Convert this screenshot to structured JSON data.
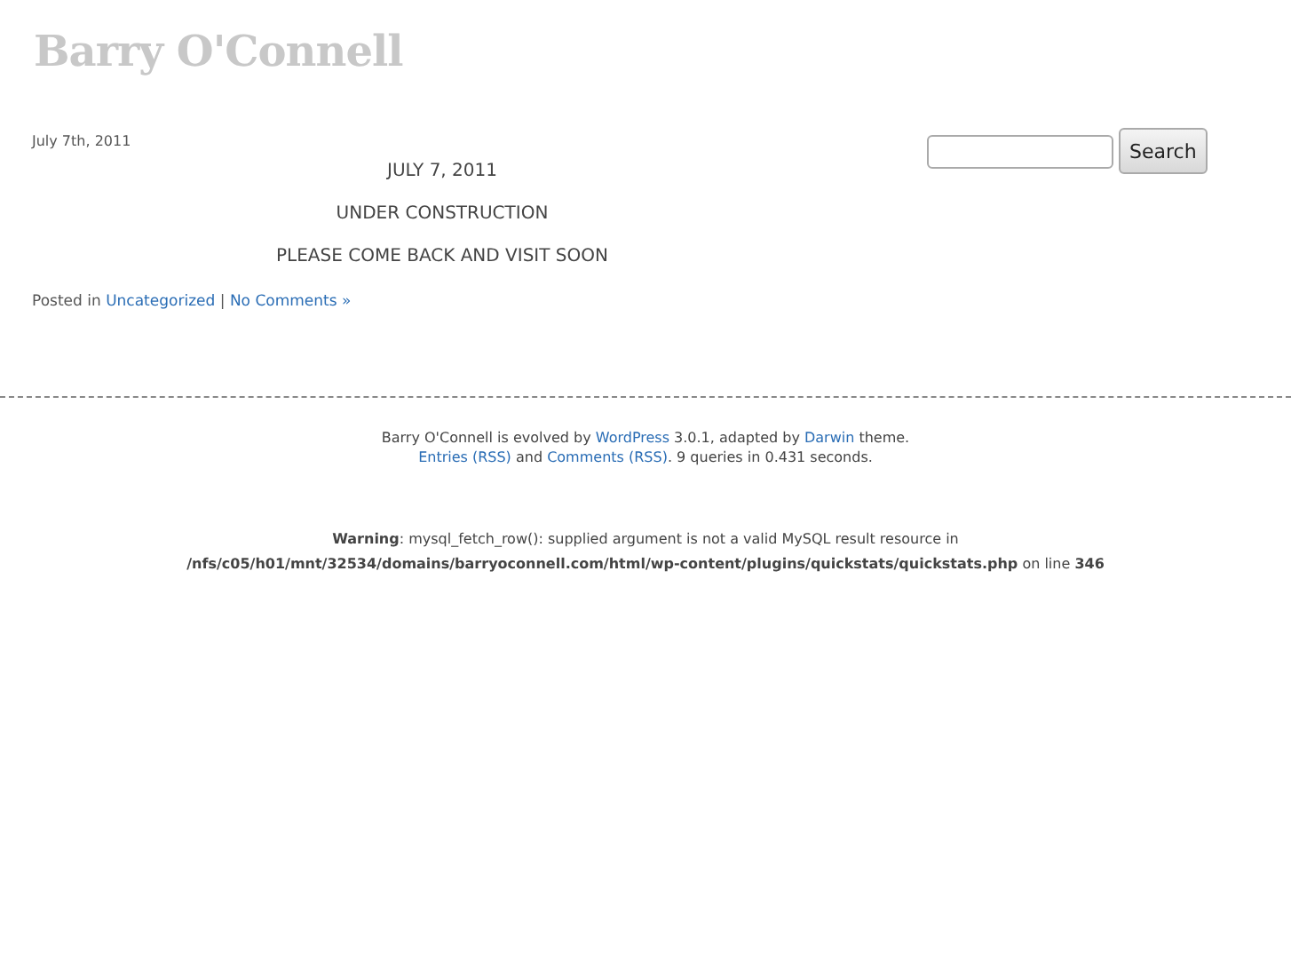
{
  "site_title": "Barry O'Connell",
  "post": {
    "date": "July 7th, 2011",
    "lines": [
      "JULY 7, 2011",
      "UNDER CONSTRUCTION",
      "PLEASE COME BACK AND VISIT SOON"
    ],
    "meta": [
      {
        "kind": "text",
        "text": "Posted in "
      },
      {
        "kind": "link",
        "text": "Uncategorized"
      },
      {
        "kind": "text",
        "text": " | "
      },
      {
        "kind": "link",
        "text": "No Comments »"
      }
    ]
  },
  "search": {
    "button": "Search"
  },
  "footer": {
    "lines": [
      [
        {
          "kind": "text",
          "text": "Barry O'Connell is evolved by "
        },
        {
          "kind": "link",
          "text": "WordPress"
        },
        {
          "kind": "text",
          "text": " 3.0.1, adapted by "
        },
        {
          "kind": "link",
          "text": "Darwin"
        },
        {
          "kind": "text",
          "text": " theme."
        }
      ],
      [
        {
          "kind": "link",
          "text": "Entries (RSS)"
        },
        {
          "kind": "text",
          "text": " and "
        },
        {
          "kind": "link",
          "text": "Comments (RSS)"
        },
        {
          "kind": "text",
          "text": ". 9 queries in 0.431 seconds."
        }
      ]
    ]
  },
  "warning": "**Warning**: mysql_fetch_row(): supplied argument is not a valid MySQL result resource in **/nfs/c05/h01/mnt/32534/domains/barryoconnell.com/html/wp-content/plugins/quickstats/quickstats.php** on line **346**"
}
